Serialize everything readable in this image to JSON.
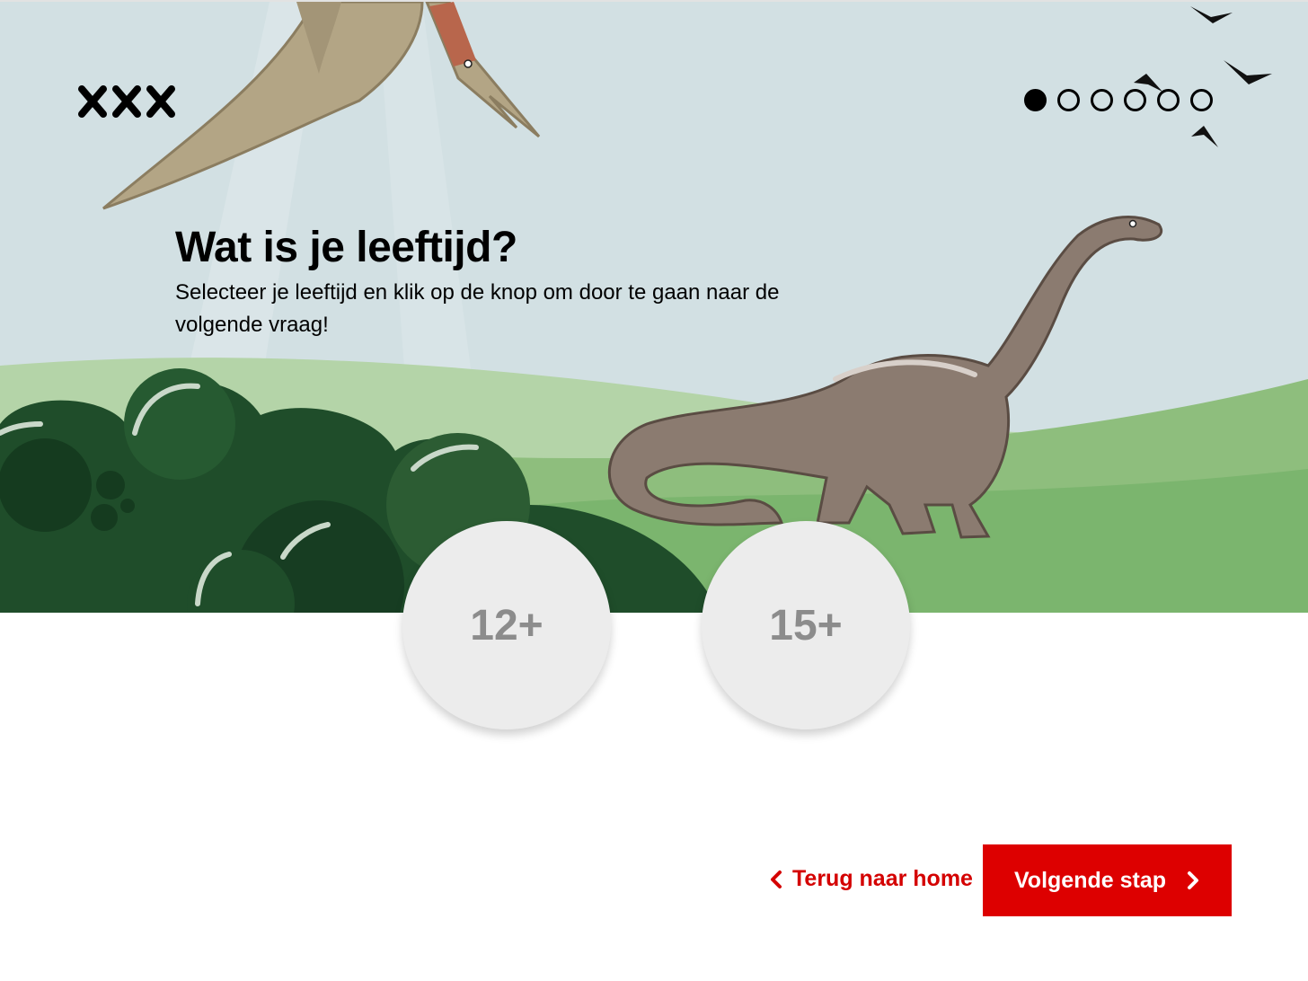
{
  "header": {
    "logo_icon": "amsterdam-xxx-logo-icon",
    "progress": {
      "total_steps": 6,
      "current_step": 1
    }
  },
  "question": {
    "title": "Wat is je leeftijd?",
    "subtitle": "Selecteer je leeftijd en klik op de knop om door te gaan naar de volgende vraag!"
  },
  "age_options": [
    {
      "label": "12+"
    },
    {
      "label": "15+"
    }
  ],
  "footer": {
    "back_label": "Terug naar home",
    "back_icon": "chevron-left-icon",
    "next_label": "Volgende stap",
    "next_icon": "chevron-right-icon"
  },
  "colors": {
    "accent": "#dd0000",
    "sky": "#d4e1e4",
    "option_bg": "#ececec",
    "option_text": "#8c8c8c"
  }
}
